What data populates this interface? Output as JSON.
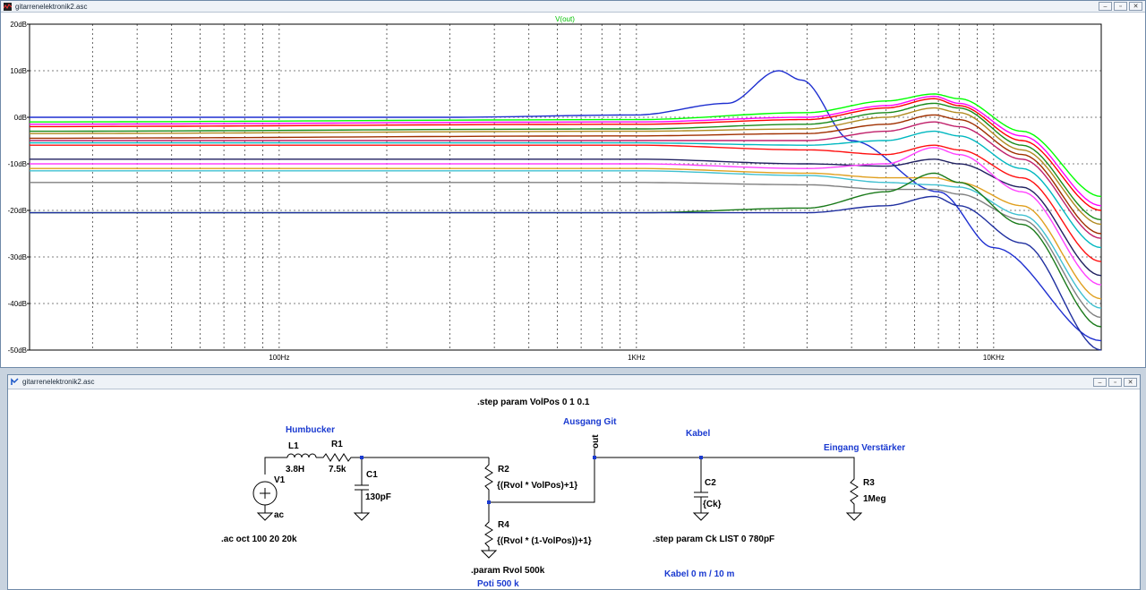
{
  "plot_window": {
    "title": "gitarrenelektronik2.asc",
    "trace_label": "V(out)",
    "trace_color": "#00ff00"
  },
  "schematic_window": {
    "title": "gitarrenelektronik2.asc"
  },
  "window_buttons": {
    "minimize": "–",
    "restore": "▫",
    "close": "✕"
  },
  "chart_data": {
    "type": "line",
    "title": "V(out)",
    "xscale": "log",
    "xlim": [
      20,
      20000
    ],
    "ylim": [
      -50,
      20
    ],
    "y_ticks": [
      "20dB",
      "10dB",
      "0dB",
      "-10dB",
      "-20dB",
      "-30dB",
      "-40dB",
      "-50dB"
    ],
    "x_ticks": [
      "100Hz",
      "1KHz",
      "10KHz"
    ],
    "grid": true,
    "series": [
      {
        "color": "#1e2fd0",
        "values": [
          [
            20,
            0
          ],
          [
            300,
            0
          ],
          [
            1000,
            0.5
          ],
          [
            1800,
            3
          ],
          [
            2500,
            10
          ],
          [
            2900,
            8
          ],
          [
            4000,
            -5
          ],
          [
            7000,
            -16
          ],
          [
            10000,
            -28
          ],
          [
            20000,
            -48
          ]
        ]
      },
      {
        "color": "#00ff00",
        "values": [
          [
            20,
            -1
          ],
          [
            1000,
            -0.5
          ],
          [
            3000,
            1
          ],
          [
            5000,
            3.5
          ],
          [
            6800,
            5
          ],
          [
            8000,
            4
          ],
          [
            12000,
            -3
          ],
          [
            20000,
            -17
          ]
        ]
      },
      {
        "color": "#ff00ff",
        "values": [
          [
            20,
            -1.5
          ],
          [
            1000,
            -1
          ],
          [
            3000,
            0
          ],
          [
            5000,
            2.5
          ],
          [
            6800,
            4.5
          ],
          [
            8000,
            3
          ],
          [
            12000,
            -4
          ],
          [
            20000,
            -19
          ]
        ]
      },
      {
        "color": "#ff0000",
        "values": [
          [
            20,
            -2
          ],
          [
            1000,
            -1.5
          ],
          [
            3000,
            -0.5
          ],
          [
            5000,
            2
          ],
          [
            6800,
            4
          ],
          [
            8000,
            2.5
          ],
          [
            12000,
            -5
          ],
          [
            20000,
            -20
          ]
        ]
      },
      {
        "color": "#1a8a1a",
        "values": [
          [
            20,
            -3
          ],
          [
            1000,
            -2.5
          ],
          [
            3000,
            -1.5
          ],
          [
            5000,
            1
          ],
          [
            6800,
            3
          ],
          [
            8000,
            2
          ],
          [
            12000,
            -6
          ],
          [
            20000,
            -22
          ]
        ]
      },
      {
        "color": "#b08a20",
        "values": [
          [
            20,
            -3.5
          ],
          [
            1000,
            -3
          ],
          [
            3000,
            -2.5
          ],
          [
            5000,
            0
          ],
          [
            6800,
            2
          ],
          [
            8000,
            1
          ],
          [
            12000,
            -7
          ],
          [
            20000,
            -23
          ]
        ]
      },
      {
        "color": "#a03000",
        "values": [
          [
            20,
            -4.5
          ],
          [
            1000,
            -4
          ],
          [
            3000,
            -3.5
          ],
          [
            5000,
            -1.5
          ],
          [
            6800,
            0.5
          ],
          [
            8000,
            -0.5
          ],
          [
            12000,
            -8
          ],
          [
            20000,
            -25
          ]
        ]
      },
      {
        "color": "#c0206a",
        "values": [
          [
            20,
            -5
          ],
          [
            1000,
            -5
          ],
          [
            3000,
            -5
          ],
          [
            5000,
            -3
          ],
          [
            6800,
            -1
          ],
          [
            8000,
            -2
          ],
          [
            12000,
            -9
          ],
          [
            20000,
            -26
          ]
        ]
      },
      {
        "color": "#00b8c0",
        "values": [
          [
            20,
            -5.5
          ],
          [
            1000,
            -5.5
          ],
          [
            3000,
            -6
          ],
          [
            5000,
            -5
          ],
          [
            6800,
            -3
          ],
          [
            8000,
            -4
          ],
          [
            12000,
            -11
          ],
          [
            20000,
            -28
          ]
        ]
      },
      {
        "color": "#ff1010",
        "values": [
          [
            20,
            -6
          ],
          [
            1000,
            -6
          ],
          [
            3000,
            -7
          ],
          [
            5000,
            -8
          ],
          [
            6800,
            -6
          ],
          [
            8000,
            -7
          ],
          [
            12000,
            -13
          ],
          [
            20000,
            -31
          ]
        ]
      },
      {
        "color": "#202060",
        "values": [
          [
            20,
            -9
          ],
          [
            1000,
            -9
          ],
          [
            3000,
            -10
          ],
          [
            5000,
            -10.5
          ],
          [
            6800,
            -9
          ],
          [
            8000,
            -10
          ],
          [
            12000,
            -15
          ],
          [
            20000,
            -34
          ]
        ]
      },
      {
        "color": "#ff40ff",
        "values": [
          [
            20,
            -10
          ],
          [
            1000,
            -10
          ],
          [
            3000,
            -11
          ],
          [
            5000,
            -10
          ],
          [
            6800,
            -6.5
          ],
          [
            8000,
            -8
          ],
          [
            12000,
            -16
          ],
          [
            20000,
            -36
          ]
        ]
      },
      {
        "color": "#e0a020",
        "values": [
          [
            20,
            -11
          ],
          [
            1000,
            -11
          ],
          [
            3000,
            -12
          ],
          [
            5000,
            -13
          ],
          [
            6800,
            -13
          ],
          [
            8000,
            -14
          ],
          [
            12000,
            -19
          ],
          [
            20000,
            -39
          ]
        ]
      },
      {
        "color": "#40c0d0",
        "values": [
          [
            20,
            -11.5
          ],
          [
            1000,
            -11.5
          ],
          [
            3000,
            -12.5
          ],
          [
            5000,
            -14
          ],
          [
            6800,
            -14.5
          ],
          [
            8000,
            -15
          ],
          [
            12000,
            -21
          ],
          [
            20000,
            -41
          ]
        ]
      },
      {
        "color": "#808080",
        "values": [
          [
            20,
            -14
          ],
          [
            1000,
            -14
          ],
          [
            3000,
            -14.5
          ],
          [
            5000,
            -15.5
          ],
          [
            6800,
            -15.5
          ],
          [
            8000,
            -16.5
          ],
          [
            12000,
            -22
          ],
          [
            20000,
            -43
          ]
        ]
      },
      {
        "color": "#1a7a1a",
        "values": [
          [
            20,
            -20.5
          ],
          [
            1000,
            -20.5
          ],
          [
            3000,
            -19.5
          ],
          [
            5000,
            -16
          ],
          [
            6800,
            -12
          ],
          [
            8000,
            -14
          ],
          [
            12000,
            -23
          ],
          [
            20000,
            -45
          ]
        ]
      },
      {
        "color": "#2030a0",
        "values": [
          [
            20,
            -20.5
          ],
          [
            1000,
            -20.5
          ],
          [
            3000,
            -20.5
          ],
          [
            5000,
            -19
          ],
          [
            6800,
            -17
          ],
          [
            8000,
            -19
          ],
          [
            12000,
            -27
          ],
          [
            20000,
            -50
          ]
        ]
      }
    ]
  },
  "schematic": {
    "step_vol": ".step param VolPos 0 1 0.1",
    "humbucker": "Humbucker",
    "l1_name": "L1",
    "l1_value": "3.8H",
    "r1_name": "R1",
    "r1_value": "7.5k",
    "v1_name": "V1",
    "v1_value": "ac",
    "c1_name": "C1",
    "c1_value": "130pF",
    "r2_name": "R2",
    "r2_value": "{(Rvol * VolPos)+1}",
    "r4_name": "R4",
    "r4_value": "{(Rvol * (1-VolPos))+1}",
    "ausgang": "Ausgang Git",
    "out_label": "out",
    "kabel": "Kabel",
    "c2_name": "C2",
    "c2_value": "{Ck}",
    "eingang": "Eingang Verstärker",
    "r3_name": "R3",
    "r3_value": "1Meg",
    "ac_cmd": ".ac oct 100 20 20k",
    "param_rvol": ".param Rvol 500k",
    "poti": "Poti 500 k",
    "step_ck": ".step param Ck LIST 0 780pF",
    "kabel_len": "Kabel 0 m / 10 m"
  }
}
